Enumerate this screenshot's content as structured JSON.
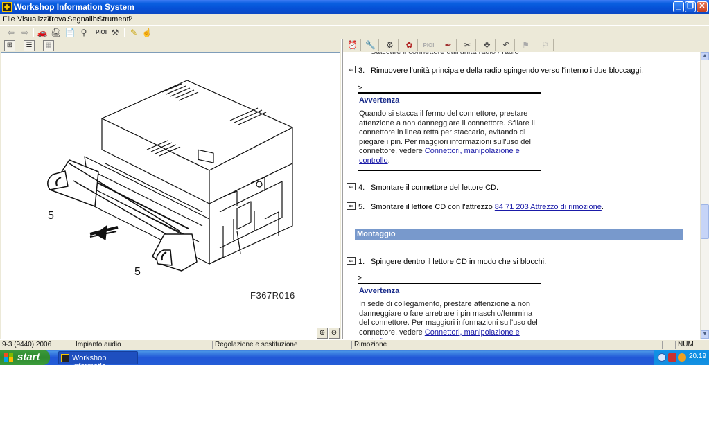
{
  "window": {
    "title": "Workshop Information System"
  },
  "menu": [
    "File",
    "Visualizza",
    "Trova",
    "Segnalibri",
    "Strumenti",
    "?"
  ],
  "toolbar": {
    "icons": [
      "back-arrow-icon",
      "forward-arrow-icon",
      "car-icon",
      "printer-icon",
      "document-icon",
      "binoculars-icon",
      "pi-icon",
      "tools-icon",
      "pencil-icon",
      "hand-icon"
    ],
    "pi_label": "PIOI"
  },
  "right_toolbar": {
    "pi_label": "PIOI",
    "icons": [
      "clock-icon",
      "wrench-icon",
      "gears-icon",
      "component-icon",
      "pi-icon",
      "tool-icon",
      "tweezers-icon",
      "move-icon",
      "undo-icon",
      "flag-icon",
      "flag2-icon"
    ]
  },
  "figure": {
    "caption": "F367R016",
    "callout_left": "5",
    "callout_right": "5"
  },
  "doc": {
    "step3": {
      "num": "3.",
      "text": "Rimuovere l'unità principale della radio spingendo verso l'interno i due bloccaggi."
    },
    "warning1": {
      "marker": ">",
      "title": "Avvertenza",
      "text": "Quando si stacca il fermo del connettore, prestare attenzione a non danneggiare il connettore. Sfilare il connettore in linea retta per staccarlo, evitando di piegare i pin. Per maggiori informazioni sull'uso del connettore, vedere ",
      "link": "Connettori, manipolazione e controllo",
      "after": "."
    },
    "step4": {
      "num": "4.",
      "text": "Smontare il connettore del lettore CD."
    },
    "step5": {
      "num": "5.",
      "text": "Smontare il lettore CD con l'attrezzo ",
      "link": "84 71 203 Attrezzo di rimozione",
      "after": "."
    },
    "section": "Montaggio",
    "step1": {
      "num": "1.",
      "text": "Spingere dentro il lettore CD in modo che si blocchi."
    },
    "warning2": {
      "marker": ">",
      "title": "Avvertenza",
      "text": "In sede di collegamento, prestare attenzione a non danneggiare o fare arretrare i pin maschio/femmina del connettore. Per maggiori informazioni sull'uso del connettore, vedere ",
      "link": "Connettori, manipolazione e controllo"
    }
  },
  "statusbar": {
    "model": "9-3 (9440) 2006",
    "system": "Impianto audio",
    "operation": "Regolazione e sostituzione",
    "step": "Rimozione",
    "num": "NUM"
  },
  "taskbar": {
    "start": "start",
    "task": "Workshop Informatio...",
    "clock": "20.19"
  }
}
